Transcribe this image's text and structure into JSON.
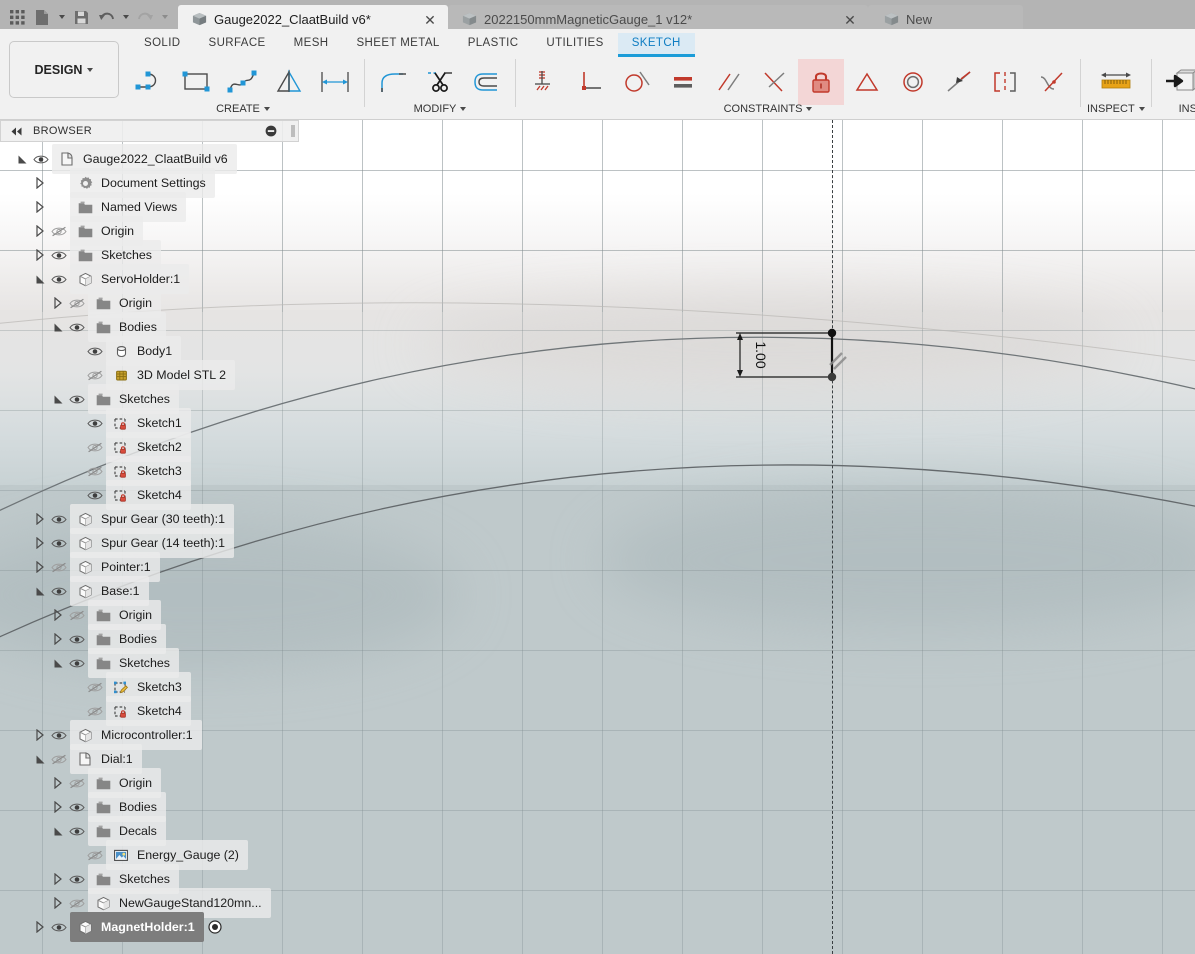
{
  "app": {
    "quick_access": [
      {
        "name": "app-grid-icon",
        "label": "Show Data Panel"
      },
      {
        "name": "new-file-icon",
        "label": "File"
      },
      {
        "name": "save-icon",
        "label": "Save"
      },
      {
        "name": "undo-icon",
        "label": "Undo"
      },
      {
        "name": "redo-icon",
        "label": "Redo"
      }
    ],
    "tabs": [
      {
        "label": "Gauge2022_ClaatBuild v6*",
        "active": true,
        "closable": true
      },
      {
        "label": "2022150mmMagneticGauge_1 v12*",
        "active": false,
        "closable": true
      },
      {
        "label": "New",
        "active": false,
        "closable": false
      }
    ]
  },
  "ribbon": {
    "design_label": "DESIGN",
    "workspace_tabs": [
      {
        "label": "SOLID",
        "active": false
      },
      {
        "label": "SURFACE",
        "active": false
      },
      {
        "label": "MESH",
        "active": false
      },
      {
        "label": "SHEET METAL",
        "active": false
      },
      {
        "label": "PLASTIC",
        "active": false
      },
      {
        "label": "UTILITIES",
        "active": false
      },
      {
        "label": "SKETCH",
        "active": true
      }
    ],
    "groups": [
      {
        "label": "CREATE",
        "has_dropdown": true,
        "tools": [
          "line-icon",
          "rectangle-icon",
          "spline-icon",
          "mirror-icon",
          "sketch-dimension-icon"
        ]
      },
      {
        "label": "MODIFY",
        "has_dropdown": true,
        "tools": [
          "fillet-icon",
          "trim-scissors-icon",
          "offset-icon"
        ]
      },
      {
        "label": "CONSTRAINTS",
        "has_dropdown": true,
        "tools": [
          "ground-constraint-icon",
          "perpendicular-icon",
          "tangent-icon",
          "equal-icon",
          "parallel-icon",
          "perpendicular-alt-icon",
          "fix-lock-icon",
          "symmetry-triangle-icon",
          "concentric-icon",
          "midpoint-icon",
          "symmetry-bracket-icon",
          "curvature-icon"
        ]
      },
      {
        "label": "INSPECT",
        "has_dropdown": true,
        "tools": [
          "measure-ruler-icon"
        ]
      },
      {
        "label": "INSERT",
        "has_dropdown": true,
        "tools": [
          "insert-derive-icon",
          "insert-image-icon"
        ]
      }
    ]
  },
  "browser": {
    "title": "BROWSER",
    "collapse_icon": "collapse-left-icon",
    "minimize_icon": "minus-circle-icon",
    "grip_icon": "panel-grip-icon",
    "tree": [
      {
        "indent": 0,
        "arrow": "expanded",
        "eye": "visible",
        "icon": "document-icon",
        "label": "Gauge2022_ClaatBuild v6"
      },
      {
        "indent": 1,
        "arrow": "collapsed",
        "eye": "none",
        "icon": "gear-icon",
        "label": "Document Settings"
      },
      {
        "indent": 1,
        "arrow": "collapsed",
        "eye": "none",
        "icon": "folder-icon",
        "label": "Named Views"
      },
      {
        "indent": 1,
        "arrow": "collapsed",
        "eye": "hidden",
        "icon": "folder-icon",
        "label": "Origin"
      },
      {
        "indent": 1,
        "arrow": "collapsed",
        "eye": "visible",
        "icon": "folder-icon",
        "label": "Sketches"
      },
      {
        "indent": 1,
        "arrow": "expanded",
        "eye": "visible",
        "icon": "component-icon",
        "label": "ServoHolder:1"
      },
      {
        "indent": 2,
        "arrow": "collapsed",
        "eye": "hidden",
        "icon": "folder-icon",
        "label": "Origin"
      },
      {
        "indent": 2,
        "arrow": "expanded",
        "eye": "visible",
        "icon": "folder-icon",
        "label": "Bodies"
      },
      {
        "indent": 3,
        "arrow": "none",
        "eye": "visible",
        "icon": "body-icon",
        "label": "Body1"
      },
      {
        "indent": 3,
        "arrow": "none",
        "eye": "hidden",
        "icon": "mesh-body-icon",
        "label": "3D Model STL 2"
      },
      {
        "indent": 2,
        "arrow": "expanded",
        "eye": "visible",
        "icon": "folder-icon",
        "label": "Sketches"
      },
      {
        "indent": 3,
        "arrow": "none",
        "eye": "visible",
        "icon": "sketch-locked-icon",
        "label": "Sketch1"
      },
      {
        "indent": 3,
        "arrow": "none",
        "eye": "hidden",
        "icon": "sketch-locked-icon",
        "label": "Sketch2"
      },
      {
        "indent": 3,
        "arrow": "none",
        "eye": "hidden",
        "icon": "sketch-locked-icon",
        "label": "Sketch3"
      },
      {
        "indent": 3,
        "arrow": "none",
        "eye": "visible",
        "icon": "sketch-locked-icon",
        "label": "Sketch4"
      },
      {
        "indent": 1,
        "arrow": "collapsed",
        "eye": "visible",
        "icon": "component-icon",
        "label": "Spur Gear (30 teeth):1"
      },
      {
        "indent": 1,
        "arrow": "collapsed",
        "eye": "visible",
        "icon": "component-icon",
        "label": "Spur Gear (14 teeth):1"
      },
      {
        "indent": 1,
        "arrow": "collapsed",
        "eye": "hidden",
        "icon": "component-icon",
        "label": "Pointer:1"
      },
      {
        "indent": 1,
        "arrow": "expanded",
        "eye": "visible",
        "icon": "component-icon",
        "label": "Base:1"
      },
      {
        "indent": 2,
        "arrow": "collapsed",
        "eye": "hidden",
        "icon": "folder-icon",
        "label": "Origin"
      },
      {
        "indent": 2,
        "arrow": "collapsed",
        "eye": "visible",
        "icon": "folder-icon",
        "label": "Bodies"
      },
      {
        "indent": 2,
        "arrow": "expanded",
        "eye": "visible",
        "icon": "folder-icon",
        "label": "Sketches"
      },
      {
        "indent": 3,
        "arrow": "none",
        "eye": "hidden",
        "icon": "sketch-edit-icon",
        "label": "Sketch3"
      },
      {
        "indent": 3,
        "arrow": "none",
        "eye": "hidden",
        "icon": "sketch-locked-icon",
        "label": "Sketch4"
      },
      {
        "indent": 1,
        "arrow": "collapsed",
        "eye": "visible",
        "icon": "component-icon",
        "label": "Microcontroller:1"
      },
      {
        "indent": 1,
        "arrow": "expanded",
        "eye": "hidden",
        "icon": "document-icon",
        "label": "Dial:1"
      },
      {
        "indent": 2,
        "arrow": "collapsed",
        "eye": "hidden",
        "icon": "folder-icon",
        "label": "Origin"
      },
      {
        "indent": 2,
        "arrow": "collapsed",
        "eye": "visible",
        "icon": "folder-icon",
        "label": "Bodies"
      },
      {
        "indent": 2,
        "arrow": "expanded",
        "eye": "visible",
        "icon": "folder-icon",
        "label": "Decals"
      },
      {
        "indent": 3,
        "arrow": "none",
        "eye": "hidden",
        "icon": "decal-image-icon",
        "label": "Energy_Gauge (2)"
      },
      {
        "indent": 2,
        "arrow": "collapsed",
        "eye": "visible",
        "icon": "folder-icon",
        "label": "Sketches"
      },
      {
        "indent": 2,
        "arrow": "collapsed",
        "eye": "hidden",
        "icon": "linked-component-icon",
        "label": "NewGaugeStand120mn..."
      },
      {
        "indent": 1,
        "arrow": "collapsed",
        "eye": "visible",
        "icon": "component-icon",
        "label": "MagnetHolder:1",
        "selected": true,
        "after": "activated-radio-icon"
      }
    ]
  },
  "canvas": {
    "dimension_label": "1.00",
    "construction_axis": "vertical-dashed-axis",
    "constraint_marker": "parallel-constraint-glyph",
    "colors": {
      "body_fill": "#bfc9cb",
      "grid_line": "#78848755",
      "sketch_line": "#3a3f42",
      "accent": "#1b9cd8"
    }
  }
}
